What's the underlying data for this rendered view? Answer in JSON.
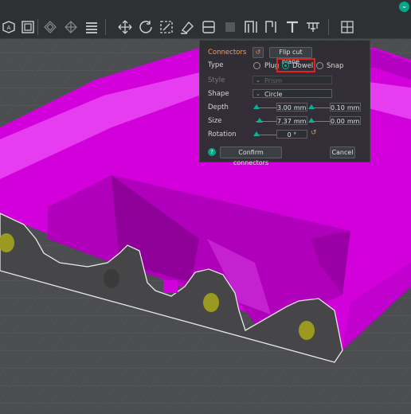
{
  "toolbar": {
    "icons": [
      "arrange-icon",
      "layout-icon",
      "grid-icon",
      "split-objects-icon",
      "layers-icon",
      "move-icon",
      "rotate-icon",
      "scale-icon",
      "paint-icon",
      "cut-icon",
      "support-icon",
      "seam-icon",
      "text-icon",
      "measure-icon",
      "assembly-icon"
    ],
    "collapse_glyph": "⌄"
  },
  "panel": {
    "connectors_label": "Connectors",
    "flip_label": "Flip cut plane",
    "type_label": "Type",
    "type_options": [
      "Plug",
      "Dowel",
      "Snap"
    ],
    "type_selected": "Dowel",
    "style_label": "Style",
    "style_value": "Prism",
    "shape_label": "Shape",
    "shape_value": "Circle",
    "depth_label": "Depth",
    "depth_value": "3.00",
    "depth_tol": "0.10",
    "size_label": "Size",
    "size_value": "7.37",
    "size_tol": "0.00",
    "rotation_label": "Rotation",
    "rotation_value": "0 °",
    "unit": "mm",
    "confirm_label": "Confirm connectors",
    "cancel_label": "Cancel",
    "help_glyph": "?",
    "reset_glyph": "↺"
  },
  "colors": {
    "model": "#d800e0",
    "cut_face": "#4a4a4c",
    "dowel_hole": "#9a9a20",
    "accent": "#00b894",
    "highlight": "#e0241c"
  }
}
